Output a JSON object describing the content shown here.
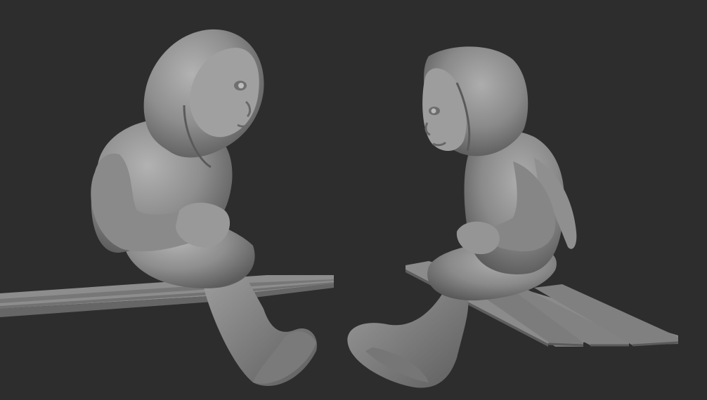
{
  "colors": {
    "background": "#2d2d2d",
    "clay_light": "#a3a3a3",
    "clay_mid": "#8c8c8c",
    "clay_dark": "#6e6e6e",
    "clay_shadow": "#4a4a4a",
    "bench_top": "#8a8a8a",
    "bench_side": "#6a6a6a"
  }
}
